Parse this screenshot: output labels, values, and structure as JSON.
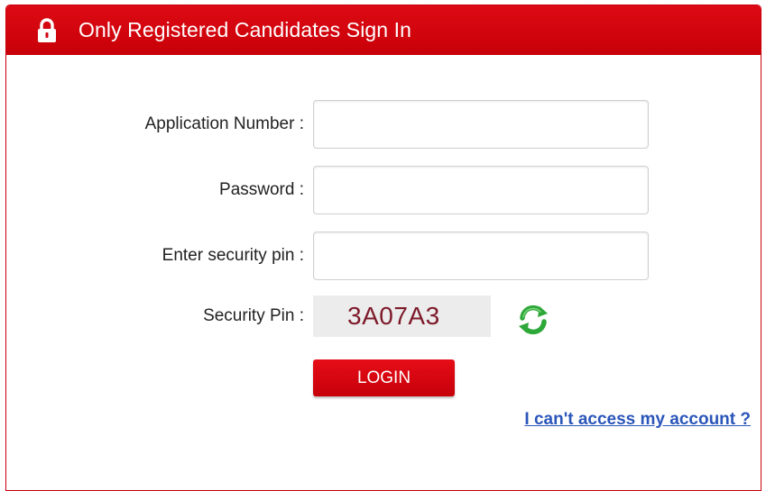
{
  "header": {
    "title": "Only Registered Candidates Sign In",
    "icon": "lock-icon"
  },
  "form": {
    "application_number_label": "Application Number :",
    "application_number_value": "",
    "password_label": "Password :",
    "password_value": "",
    "security_pin_input_label": "Enter security pin :",
    "security_pin_input_value": "",
    "security_pin_label": "Security Pin :",
    "security_pin_code": "3A07A3",
    "refresh_icon": "refresh-icon"
  },
  "actions": {
    "login_label": "LOGIN",
    "help_link": "I can't access my account ?"
  },
  "colors": {
    "brand_red": "#d0030d",
    "link_blue": "#2a55b9",
    "captcha_text": "#7d1a2a",
    "refresh_green": "#2fa83a"
  }
}
